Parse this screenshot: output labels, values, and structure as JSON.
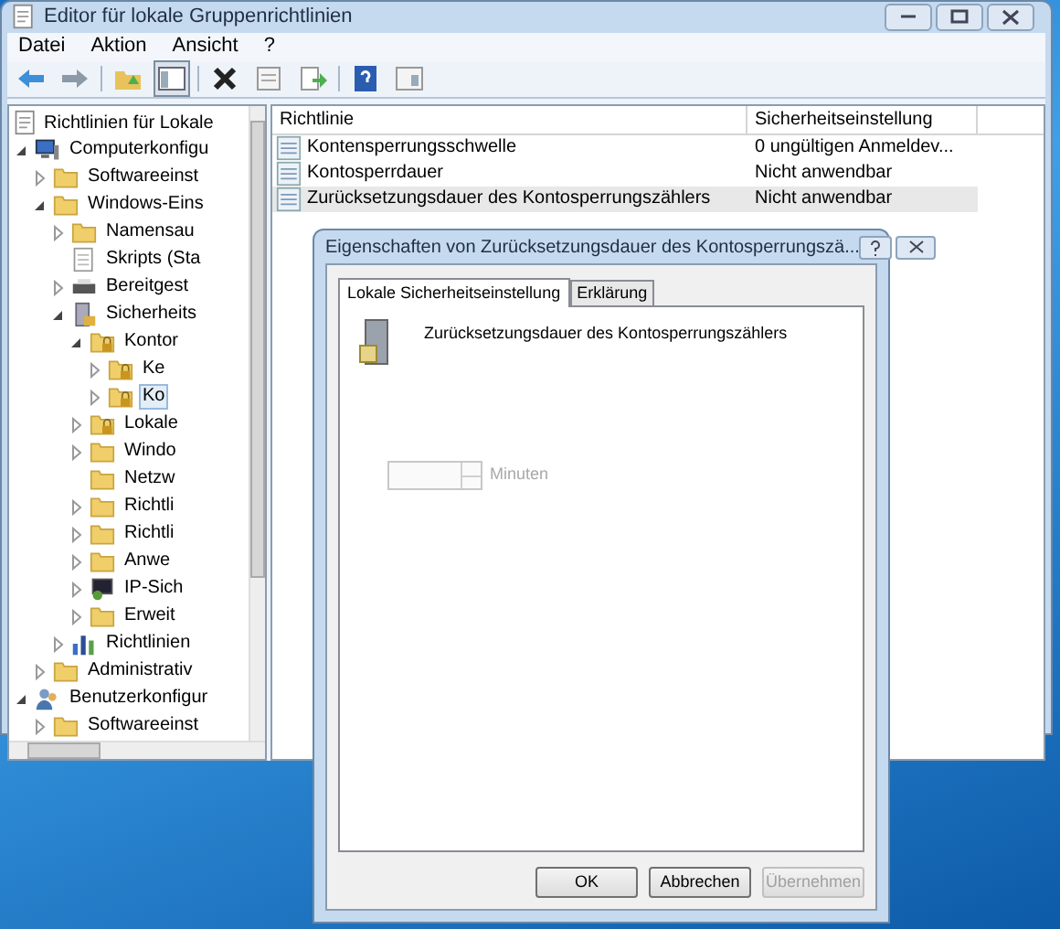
{
  "window": {
    "title": "Editor für lokale Gruppenrichtlinien"
  },
  "menu": [
    "Datei",
    "Aktion",
    "Ansicht",
    "?"
  ],
  "toolbar": [
    {
      "kind": "back",
      "pressed": false
    },
    {
      "kind": "forward",
      "pressed": false
    },
    {
      "kind": "sep"
    },
    {
      "kind": "up",
      "pressed": false
    },
    {
      "kind": "tree",
      "pressed": true
    },
    {
      "kind": "sep"
    },
    {
      "kind": "delete",
      "pressed": false
    },
    {
      "kind": "properties",
      "pressed": false
    },
    {
      "kind": "export",
      "pressed": false
    },
    {
      "kind": "sep"
    },
    {
      "kind": "help",
      "pressed": false
    },
    {
      "kind": "view",
      "pressed": false
    }
  ],
  "tree": {
    "label": "Richtlinien für Lokale",
    "kind": "doc",
    "selected": false,
    "children": [
      {
        "label": "Computerkonfigu",
        "kind": "computer",
        "expanded": true,
        "selected": false,
        "children": [
          {
            "label": "Softwareeinst",
            "kind": "folder",
            "expanded": false,
            "selected": false
          },
          {
            "label": "Windows-Eins",
            "kind": "folder",
            "expanded": true,
            "selected": false,
            "children": [
              {
                "label": "Namensau",
                "kind": "folder",
                "expanded": false,
                "selected": false
              },
              {
                "label": "Skripts (Sta",
                "kind": "script",
                "selected": false
              },
              {
                "label": "Bereitgest",
                "kind": "printer",
                "expanded": false,
                "selected": false
              },
              {
                "label": "Sicherheits",
                "kind": "security",
                "expanded": true,
                "selected": false,
                "children": [
                  {
                    "label": "Kontor",
                    "kind": "lockfolder",
                    "expanded": true,
                    "selected": false,
                    "children": [
                      {
                        "label": "Ke",
                        "kind": "lockfolder",
                        "expanded": false,
                        "selected": false
                      },
                      {
                        "label": "Ko",
                        "kind": "lockfolder",
                        "expanded": false,
                        "selected": true
                      }
                    ]
                  },
                  {
                    "label": "Lokale",
                    "kind": "lockfolder",
                    "expanded": false,
                    "selected": false
                  },
                  {
                    "label": "Windo",
                    "kind": "folder",
                    "expanded": false,
                    "selected": false
                  },
                  {
                    "label": "Netzw",
                    "kind": "folder",
                    "selected": false
                  },
                  {
                    "label": "Richtli",
                    "kind": "folder",
                    "expanded": false,
                    "selected": false
                  },
                  {
                    "label": "Richtli",
                    "kind": "folder",
                    "expanded": false,
                    "selected": false
                  },
                  {
                    "label": "Anwe",
                    "kind": "folder",
                    "expanded": false,
                    "selected": false
                  },
                  {
                    "label": "IP-Sich",
                    "kind": "network",
                    "expanded": false,
                    "selected": false
                  },
                  {
                    "label": "Erweit",
                    "kind": "folder",
                    "expanded": false,
                    "selected": false
                  }
                ]
              },
              {
                "label": "Richtlinien",
                "kind": "chart",
                "expanded": false,
                "selected": false
              }
            ]
          },
          {
            "label": "Administrativ",
            "kind": "folder",
            "expanded": false,
            "selected": false
          }
        ]
      },
      {
        "label": "Benutzerkonfigur",
        "kind": "user",
        "expanded": true,
        "selected": false,
        "children": [
          {
            "label": "Softwareeinst",
            "kind": "folder",
            "expanded": false,
            "selected": false
          }
        ]
      }
    ]
  },
  "table": {
    "columns": [
      "Richtlinie",
      "Sicherheitseinstellung"
    ],
    "rows": [
      {
        "kind": "policy",
        "name": "Kontensperrungsschwelle",
        "value": "0 ungültigen Anmeldev...",
        "selected": false
      },
      {
        "kind": "policy",
        "name": "Kontosperrdauer",
        "value": "Nicht anwendbar",
        "selected": false
      },
      {
        "kind": "policy",
        "name": "Zurücksetzungsdauer des Kontosperrungszählers",
        "value": "Nicht anwendbar",
        "selected": true
      }
    ]
  },
  "dialog": {
    "title": "Eigenschaften von Zurücksetzungsdauer des Kontosperrungszä...",
    "tabs": [
      {
        "label": "Lokale Sicherheitseinstellung",
        "selected": true
      },
      {
        "label": "Erklärung",
        "selected": false
      }
    ],
    "policy_name": "Zurücksetzungsdauer des Kontosperrungszählers",
    "spinner": {
      "disabled": true
    },
    "unit": "Minuten",
    "buttons": [
      {
        "label": "OK",
        "disabled": false
      },
      {
        "label": "Abbrechen",
        "disabled": false
      },
      {
        "label": "Übernehmen",
        "disabled": true
      }
    ]
  }
}
